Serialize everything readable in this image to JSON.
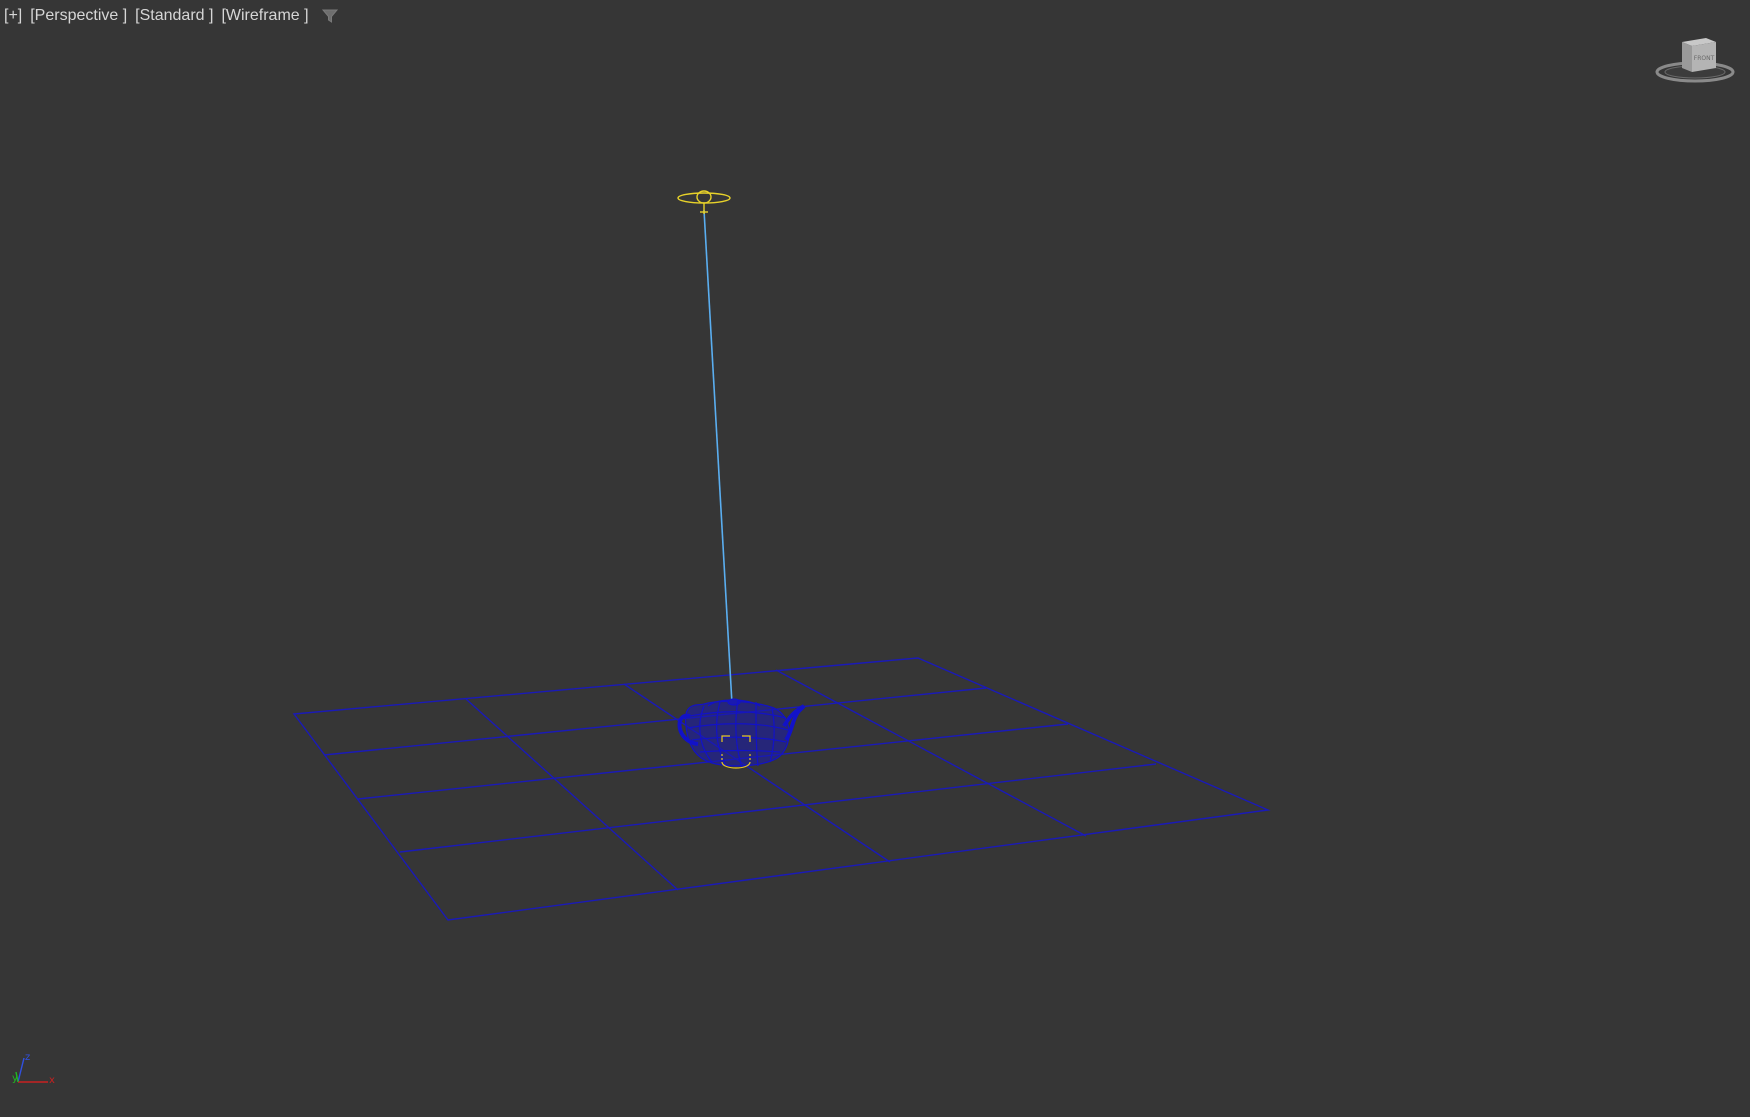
{
  "viewport": {
    "labels": {
      "plus_menu": "[+]",
      "view_menu": "[Perspective ]",
      "shading_mode": "[Standard ]",
      "display_mode": "[Wireframe ]"
    },
    "filter_icon": "filter-icon",
    "viewcube": {
      "face_label": "FRONT",
      "icon": "viewcube-icon"
    },
    "axis_tripod": {
      "x_label": "x",
      "y_label": "y",
      "z_label": "z"
    }
  },
  "colors": {
    "background": "#363636",
    "plane_wire": "#1a1ab8",
    "teapot_wire": "#1212c8",
    "light_gizmo": "#e8d22a",
    "light_target_line": "#5aaef0",
    "selection_box": "#e8c820",
    "axis_x": "#c82020",
    "axis_y": "#20b820",
    "axis_z": "#3050e0"
  }
}
